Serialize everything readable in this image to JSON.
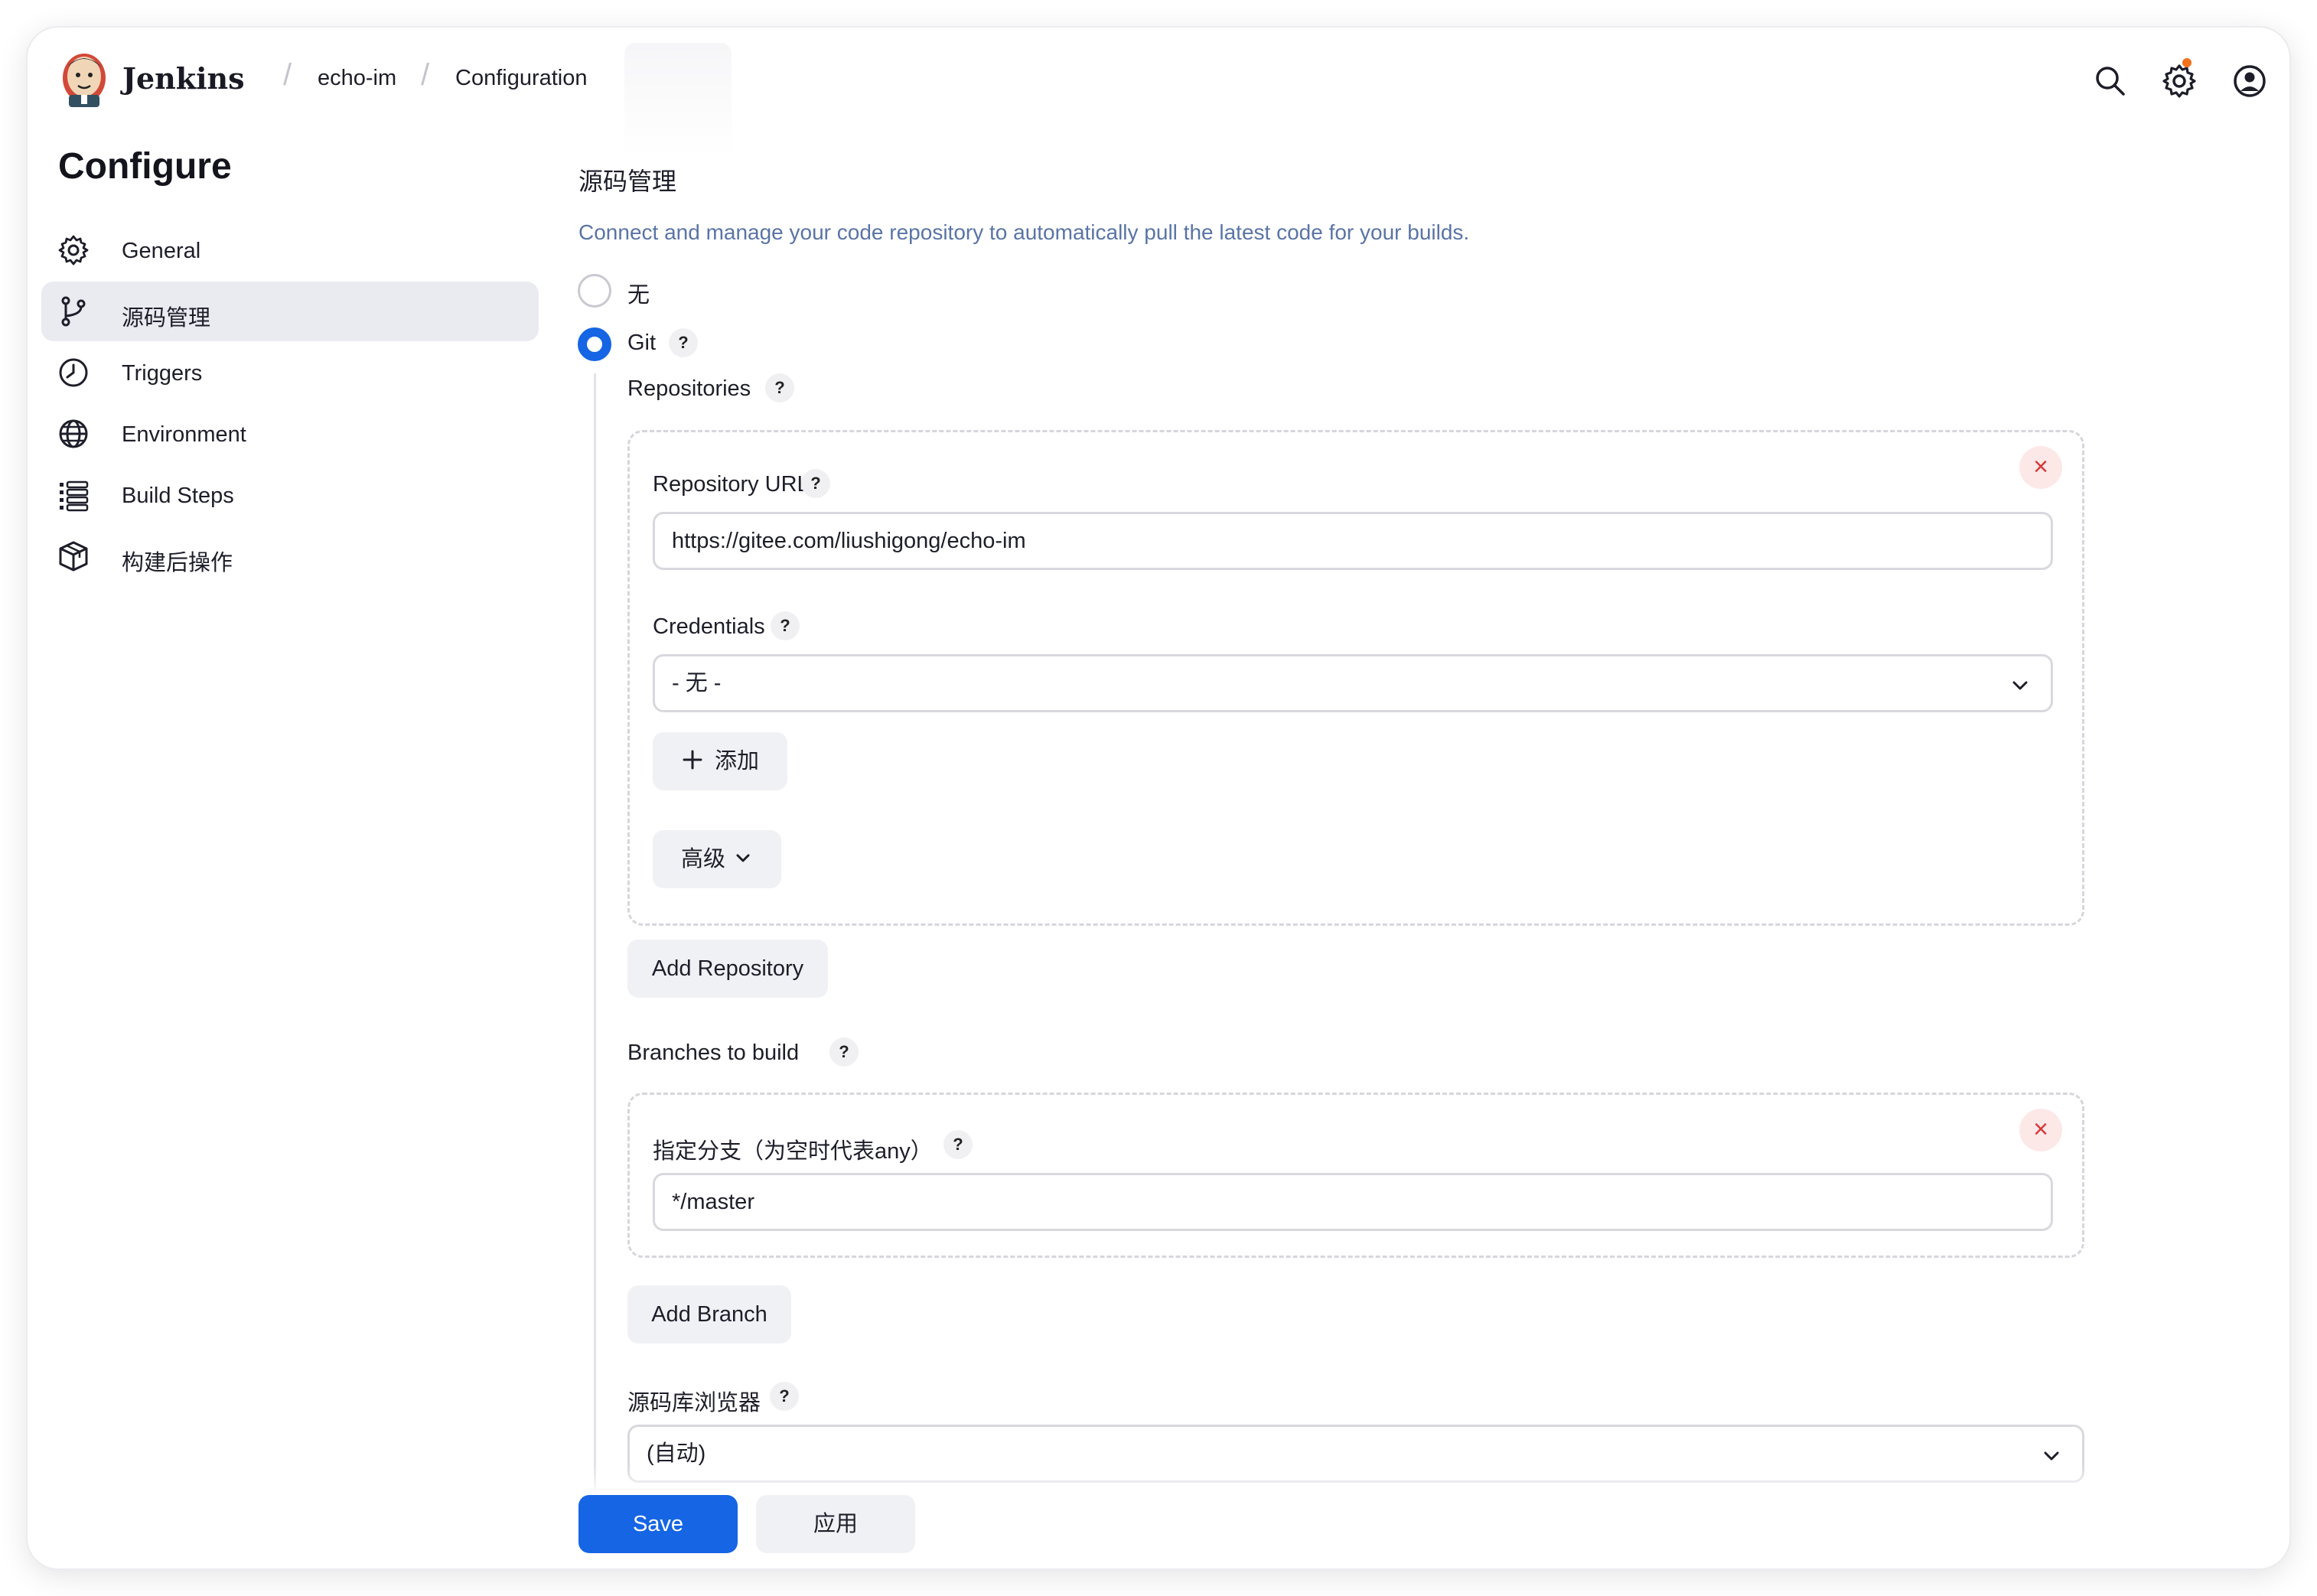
{
  "header": {
    "brand": "Jenkins",
    "breadcrumbs": [
      "echo-im",
      "Configuration"
    ],
    "icons": [
      "search-icon",
      "gear-icon",
      "user-icon"
    ],
    "notification_color": "#f2711c"
  },
  "sidebar": {
    "title": "Configure",
    "items": [
      {
        "label": "General",
        "icon": "gear-icon",
        "active": false
      },
      {
        "label": "源码管理",
        "icon": "git-branch-icon",
        "active": true
      },
      {
        "label": "Triggers",
        "icon": "clock-icon",
        "active": false
      },
      {
        "label": "Environment",
        "icon": "globe-icon",
        "active": false
      },
      {
        "label": "Build Steps",
        "icon": "list-icon",
        "active": false
      },
      {
        "label": "构建后操作",
        "icon": "package-icon",
        "active": false
      }
    ]
  },
  "main": {
    "section_title": "源码管理",
    "section_desc": "Connect and manage your code repository to automatically pull the latest code for your builds.",
    "scm_options": [
      {
        "label": "无",
        "checked": false
      },
      {
        "label": "Git",
        "checked": true
      }
    ],
    "help_symbol": "?",
    "repositories": {
      "label": "Repositories",
      "repo_url_label": "Repository URL",
      "repo_url_value": "https://gitee.com/liushigong/echo-im",
      "credentials_label": "Credentials",
      "credentials_value": "- 无 -",
      "add_label": "添加",
      "advanced_label": "高级",
      "remove_symbol": "×",
      "add_repository_label": "Add Repository"
    },
    "branches": {
      "label": "Branches to build",
      "branch_spec_label": "指定分支（为空时代表any）",
      "branch_spec_value": "*/master",
      "remove_symbol": "×",
      "add_branch_label": "Add Branch"
    },
    "browser": {
      "label": "源码库浏览器",
      "value": "(自动)"
    }
  },
  "footer": {
    "save_label": "Save",
    "apply_label": "应用"
  },
  "colors": {
    "accent": "#1565e4",
    "description": "#5a74a6",
    "active_nav_bg": "#e9ebf0",
    "remove_bg": "#fde8e8",
    "remove_fg": "#d63a3a"
  }
}
